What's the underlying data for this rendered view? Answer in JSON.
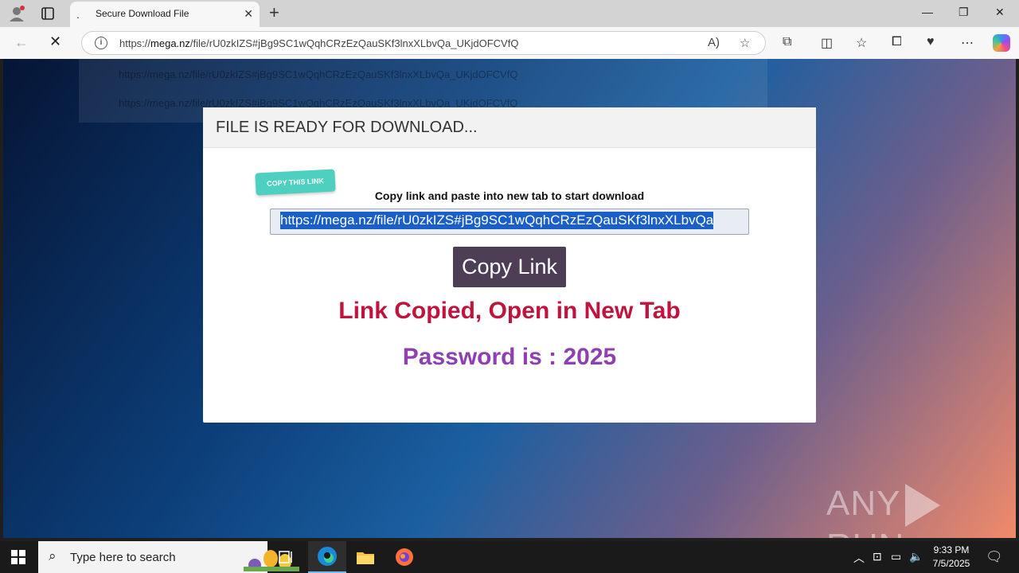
{
  "browser": {
    "tab_title": "Secure Download File",
    "tab_loading_glyph": ".",
    "url_display_prefix": "https://",
    "url_host": "mega.nz",
    "url_path": "/file/rU0zkIZS#jBg9SC1wQqhCRzEzQauSKf3lnxXLbvQa_UKjdOFCVfQ",
    "dropdown_suggestions": [
      "https://mega.nz/file/rU0zkIZS#jBg9SC1wQqhCRzEzQauSKf3lnxXLbvQa_UKjdOFCVfQ",
      "https://mega.nz/file/rU0zkIZS#jBg9SC1wQqhCRzEzQauSKf3lnxXLbvQa_UKjdOFCVfQ"
    ]
  },
  "modal": {
    "header": "FILE IS READY FOR DOWNLOAD...",
    "badge": "COPY THIS LINK",
    "instruction": "Copy link and paste into new tab to start download",
    "link_value": "https://mega.nz/file/rU0zkIZS#jBg9SC1wQqhCRzEzQauSKf3lnxXLbvQa",
    "copy_button": "Copy Link",
    "status_message": "Link Copied, Open in New Tab",
    "password_text": "Password is : 2025"
  },
  "watermark": {
    "left": "ANY",
    "right": "RUN"
  },
  "taskbar": {
    "search_placeholder": "Type here to search",
    "time": "9:33 PM",
    "date": "7/5/2025"
  },
  "colors": {
    "status_red": "#c0133d",
    "password_purple": "#8e3fb0",
    "button_bg": "#4d3d55",
    "badge_teal": "#4dd0c0",
    "selection_blue": "#1a5fc8"
  }
}
